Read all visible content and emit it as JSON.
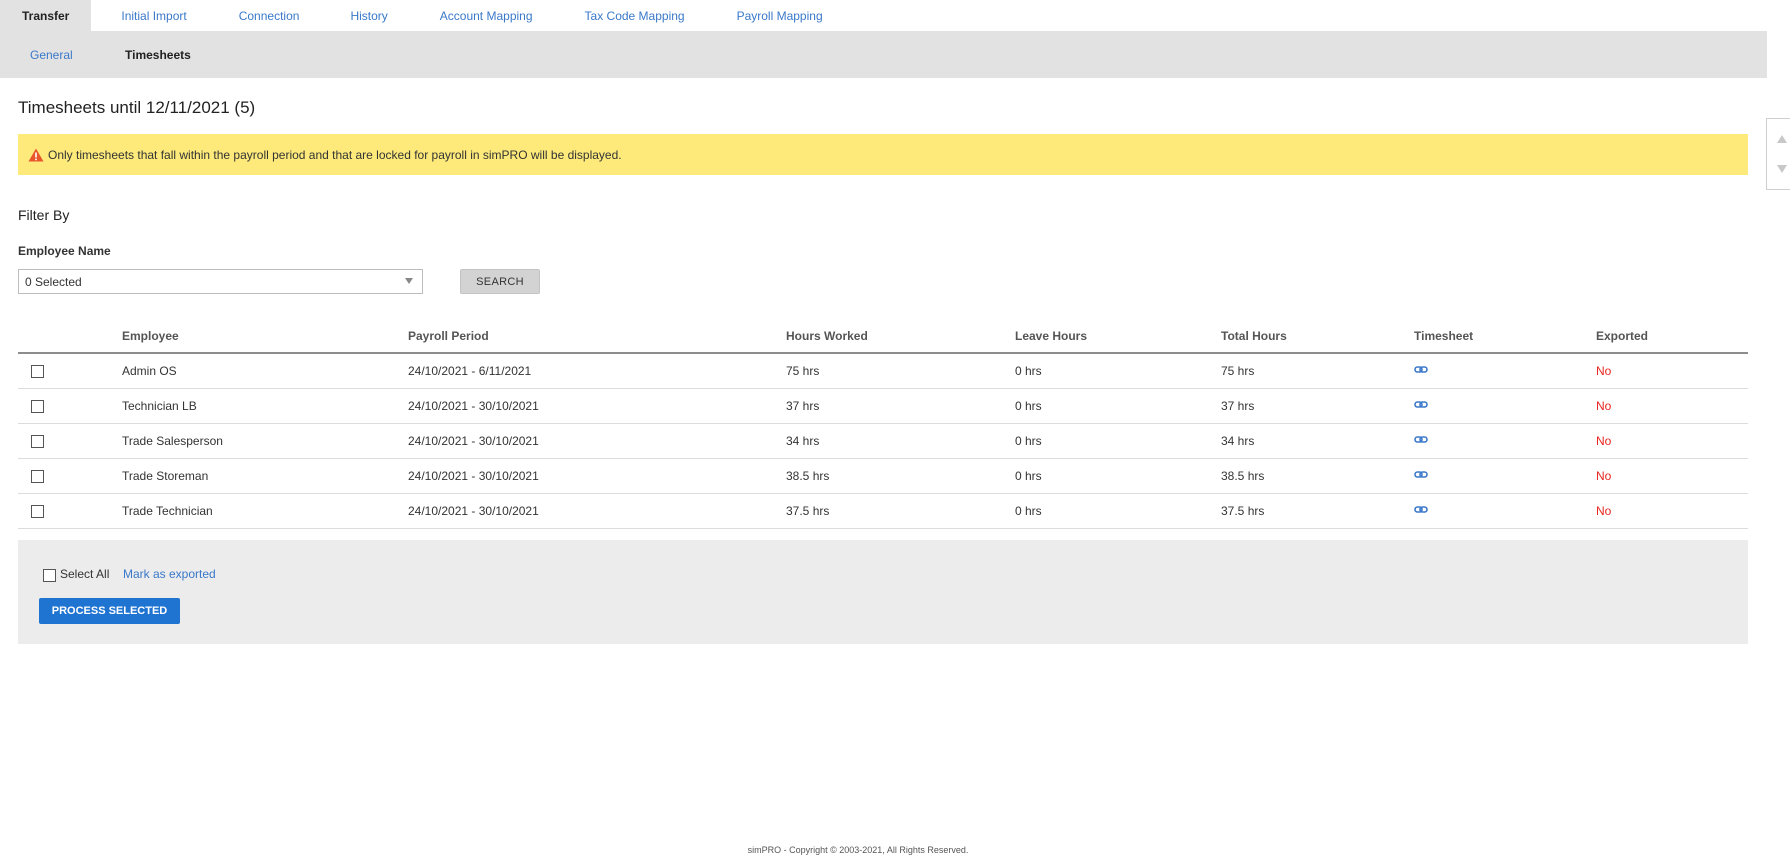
{
  "tabs": [
    {
      "label": "Transfer",
      "active": true
    },
    {
      "label": "Initial Import",
      "active": false
    },
    {
      "label": "Connection",
      "active": false
    },
    {
      "label": "History",
      "active": false
    },
    {
      "label": "Account Mapping",
      "active": false
    },
    {
      "label": "Tax Code Mapping",
      "active": false
    },
    {
      "label": "Payroll Mapping",
      "active": false
    }
  ],
  "subtabs": [
    {
      "label": "General",
      "active": false
    },
    {
      "label": "Timesheets",
      "active": true
    }
  ],
  "page": {
    "title": "Timesheets until 12/11/2021 (5)",
    "warning": "Only timesheets that fall within the payroll period and that are locked for payroll in simPRO will be displayed.",
    "warning_icon": "warning-triangle-icon"
  },
  "filter": {
    "title": "Filter By",
    "employee_label": "Employee Name",
    "employee_value": "0 Selected",
    "search_label": "SEARCH"
  },
  "table": {
    "headers": {
      "employee": "Employee",
      "period": "Payroll Period",
      "worked": "Hours Worked",
      "leave": "Leave Hours",
      "total": "Total Hours",
      "timesheet": "Timesheet",
      "exported": "Exported"
    },
    "rows": [
      {
        "employee": "Admin OS",
        "period": "24/10/2021 - 6/11/2021",
        "worked": "75 hrs",
        "leave": "0 hrs",
        "total": "75 hrs",
        "exported": "No"
      },
      {
        "employee": "Technician LB",
        "period": "24/10/2021 - 30/10/2021",
        "worked": "37 hrs",
        "leave": "0 hrs",
        "total": "37 hrs",
        "exported": "No"
      },
      {
        "employee": "Trade Salesperson",
        "period": "24/10/2021 - 30/10/2021",
        "worked": "34 hrs",
        "leave": "0 hrs",
        "total": "34 hrs",
        "exported": "No"
      },
      {
        "employee": "Trade Storeman",
        "period": "24/10/2021 - 30/10/2021",
        "worked": "38.5 hrs",
        "leave": "0 hrs",
        "total": "38.5 hrs",
        "exported": "No"
      },
      {
        "employee": "Trade Technician",
        "period": "24/10/2021 - 30/10/2021",
        "worked": "37.5 hrs",
        "leave": "0 hrs",
        "total": "37.5 hrs",
        "exported": "No"
      }
    ]
  },
  "actions": {
    "select_all": "Select All",
    "mark_exported": "Mark as exported",
    "process_selected": "PROCESS SELECTED"
  },
  "footer": {
    "copyright": "simPRO - Copyright © 2003-2021, All Rights Reserved."
  },
  "colors": {
    "accent": "#3a78c9",
    "primary_button": "#1f73d1",
    "warning_bg": "#fdea7b",
    "no_status": "#e8261f"
  }
}
